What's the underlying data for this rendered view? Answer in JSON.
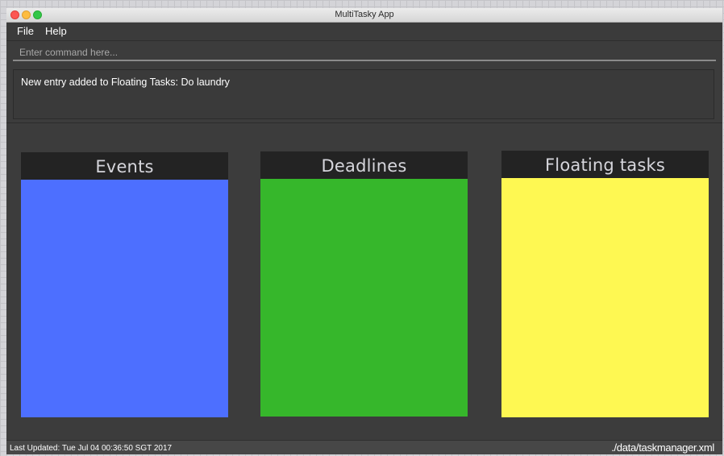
{
  "window": {
    "title": "MultiTasky App"
  },
  "menu": {
    "file_label": "File",
    "help_label": "Help"
  },
  "command": {
    "value": "",
    "placeholder": "Enter command here..."
  },
  "result": {
    "message": "New entry added to Floating Tasks: Do laundry"
  },
  "panels": [
    {
      "title": "Events",
      "color": "#4d6fff"
    },
    {
      "title": "Deadlines",
      "color": "#36b72b"
    },
    {
      "title": "Floating tasks",
      "color": "#fef852"
    }
  ],
  "status": {
    "last_updated": "Last Updated: Tue Jul 04 00:36:50 SGT 2017",
    "file_path": "./data/taskmanager.xml"
  }
}
